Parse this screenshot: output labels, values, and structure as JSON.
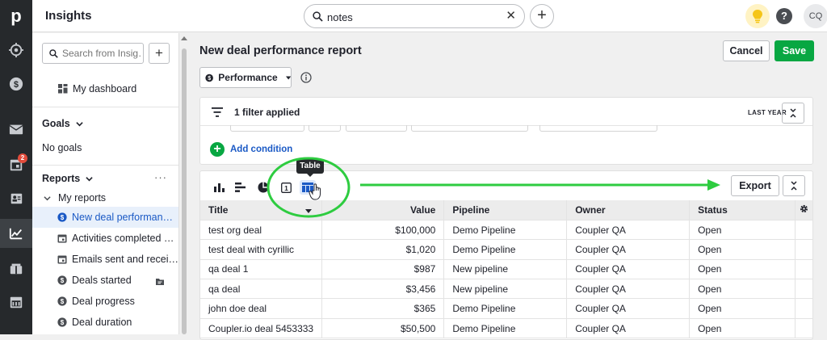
{
  "app": {
    "title": "Insights",
    "logo": "p"
  },
  "topbar": {
    "search_value": "notes",
    "avatar_initials": "CQ",
    "help_label": "?"
  },
  "rail": {
    "icons": [
      "logo",
      "target-icon",
      "dollar-icon",
      "mail-icon",
      "calendar-icon",
      "contacts-icon",
      "insights-chart-icon",
      "products-icon",
      "store-icon"
    ],
    "calendar_badge": "2"
  },
  "sidebar": {
    "search_placeholder": "Search from Insig…",
    "dashboard": "My dashboard",
    "goals_heading": "Goals",
    "no_goals": "No goals",
    "reports_heading": "Reports",
    "my_reports": "My reports",
    "reports": [
      {
        "label": "New deal performan…",
        "icon": "dollar-icon",
        "active": true
      },
      {
        "label": "Activities completed …",
        "icon": "calendar-icon",
        "active": false
      },
      {
        "label": "Emails sent and recei…",
        "icon": "calendar-icon",
        "active": false
      },
      {
        "label": "Deals started",
        "icon": "dollar-icon",
        "active": false
      },
      {
        "label": "Deal progress",
        "icon": "dollar-icon",
        "active": false
      },
      {
        "label": "Deal duration",
        "icon": "dollar-icon",
        "active": false
      }
    ]
  },
  "main": {
    "title": "New deal performance report",
    "cancel_label": "Cancel",
    "save_label": "Save",
    "view_select": "Performance",
    "filter_text": "1 filter applied",
    "period": "LAST YEAR",
    "add_condition": "Add condition",
    "export_label": "Export",
    "tooltip": "Table"
  },
  "table": {
    "columns": [
      "Title",
      "Value",
      "Pipeline",
      "Owner",
      "Status"
    ],
    "rows": [
      [
        "test org deal",
        "$100,000",
        "Demo Pipeline",
        "Coupler QA",
        "Open"
      ],
      [
        "test deal with cyrillic",
        "$1,020",
        "Demo Pipeline",
        "Coupler QA",
        "Open"
      ],
      [
        "qa deal 1",
        "$987",
        "New pipeline",
        "Coupler QA",
        "Open"
      ],
      [
        "qa deal",
        "$3,456",
        "New pipeline",
        "Coupler QA",
        "Open"
      ],
      [
        "john doe deal",
        "$365",
        "Demo Pipeline",
        "Coupler QA",
        "Open"
      ],
      [
        "Coupler.io deal 5453333",
        "$50,500",
        "Demo Pipeline",
        "Coupler QA",
        "Open"
      ]
    ]
  },
  "colors": {
    "accent_green": "#08a742",
    "link_blue": "#1a59c5",
    "annotation_green": "#2ecc40",
    "rail_dark": "#26292c"
  }
}
